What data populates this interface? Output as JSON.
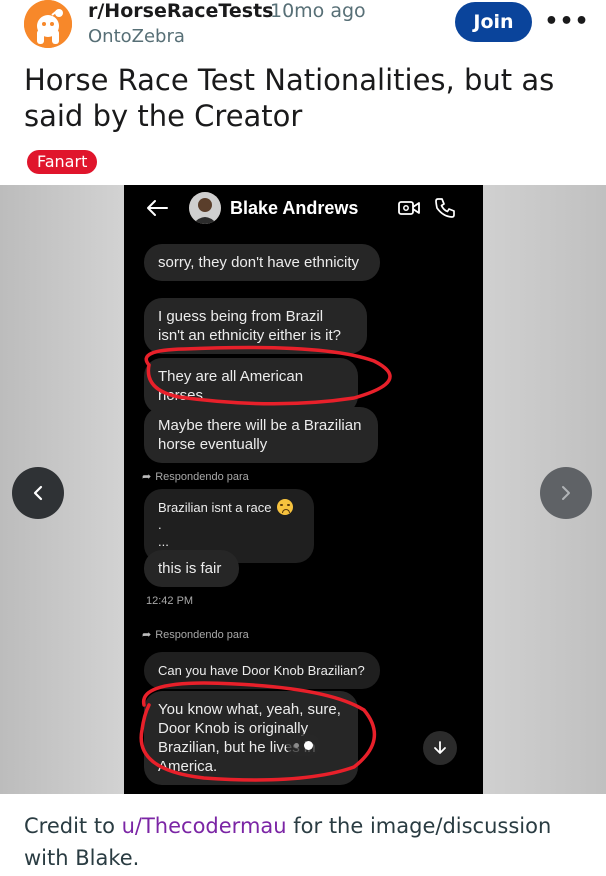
{
  "post": {
    "subreddit": "r/HorseRaceTests",
    "time_ago": "10mo ago",
    "author": "OntoZebra",
    "join_label": "Join",
    "more_label": "•••",
    "title": "Horse Race Test Nationalities, but as said by the Creator",
    "flair": "Fanart",
    "flair_color": "#e0152c",
    "join_color": "#0a449b"
  },
  "chat": {
    "contact_name": "Blake Andrews",
    "messages": [
      {
        "text": "sorry, they don't have ethnicity"
      },
      {
        "text": "I guess being from Brazil isn't an ethnicity either is it?"
      },
      {
        "text": "They are all American horses"
      },
      {
        "text": "Maybe there will be a Brazilian horse eventually"
      },
      {
        "text": "Brazilian isnt a race"
      },
      {
        "text": "this is fair"
      },
      {
        "text": "Can you have Door Knob Brazilian?"
      },
      {
        "text": "You know what, yeah, sure, Door Knob is originally Brazilian, but he lives in America."
      }
    ],
    "reply_label": "Respondendo para",
    "reply_label_2": "Respondendo para",
    "quote_suffix": ".",
    "quote_ellipsis": "...",
    "timestamp": "12:42 PM",
    "annotation_color": "#e8202a"
  },
  "gallery": {
    "dots_count": 2,
    "active_dot": 1
  },
  "credit": {
    "prefix": "Credit to ",
    "user": "u/Thecodermau",
    "suffix": " for the image/discussion with Blake."
  },
  "icons": [
    "reddit-snoo-icon",
    "more-icon",
    "chevron-left-icon",
    "chevron-right-icon",
    "back-arrow-icon",
    "video-call-icon",
    "phone-icon",
    "reply-arrow-icon",
    "crying-emoji-icon",
    "arrow-down-icon"
  ]
}
